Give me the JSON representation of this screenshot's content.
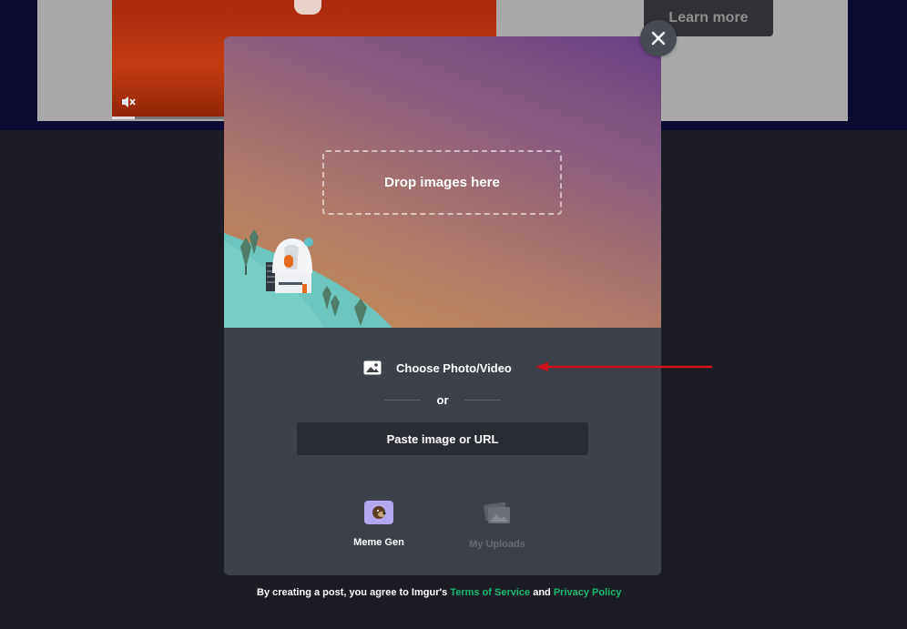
{
  "background": {
    "ad": {
      "learn_more_label": "Learn more",
      "video_progress": 0.06
    }
  },
  "upload_modal": {
    "drop_zone_text": "Drop images here",
    "choose_label": "Choose Photo/Video",
    "or_text": "or",
    "paste_label": "Paste image or URL",
    "tools": [
      {
        "label": "Meme Gen",
        "icon": "meme-gen-icon",
        "enabled": true
      },
      {
        "label": "My Uploads",
        "icon": "my-uploads-icon",
        "enabled": false
      }
    ]
  },
  "footer": {
    "prefix": "By creating a post, you agree to Imgur's",
    "terms_link": "Terms of Service",
    "and": "and",
    "privacy_link": "Privacy Policy"
  },
  "colors": {
    "accent_link": "#1bb76e",
    "modal_panel": "#3d414a",
    "button_dark": "#2a2c33",
    "annotation_arrow": "#d0121b"
  }
}
